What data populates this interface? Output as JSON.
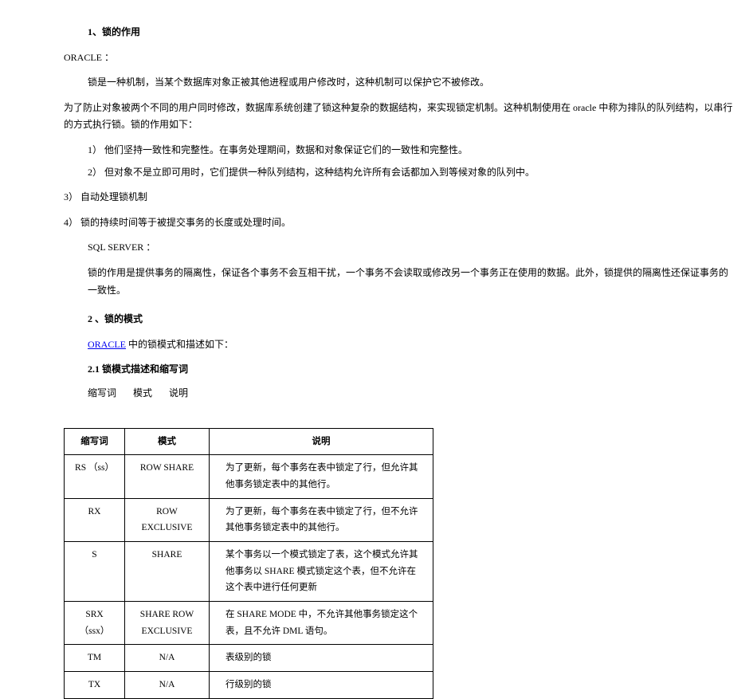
{
  "headings": {
    "h1": "1、锁的作用",
    "h2": "2 、锁的模式",
    "h2_1_title": "2.1 锁模式描述和缩写词"
  },
  "paragraphs": {
    "p_oracle_label": "ORACLE ：",
    "p_oracle_1": "锁是一种机制，当某个数据库对象正被其他进程或用户修改时，这种机制可以保护它不被修改。",
    "p_oracle_2": "为了防止对象被两个不同的用户同时修改，数据库系统创建了锁这种复杂的数据结构，来实现锁定机制。这种机制使用在  oracle 中称为排队的队列结构，以串行的方式执行锁。锁的作用如下：",
    "li1": "1）  他们坚持一致性和完整性。在事务处理期间，数据和对象保证它们的一致性和完整性。",
    "li2": "2）  但对象不是立即可用时，它们提供一种队列结构，这种结构允许所有会话都加入到等候对象的队列中。",
    "li3": "3）  自动处理锁机制",
    "li4": "4）  锁的持续时间等于被提交事务的长度或处理时间。",
    "p_sql_label": "SQL SERVER ：",
    "p_sql_1": "锁的作用是提供事务的隔离性，保证各个事务不会互相干扰，一个事务不会读取或修改另一个事务正在使用的数据。此外，锁提供的隔离性还保证事务的一致性。",
    "p_h2_sub_prefix": "ORACLE",
    "p_h2_sub": " 中的锁模式和描述如下：",
    "labels_abbr": "缩写词",
    "labels_mode": "模式",
    "labels_desc": "说明"
  },
  "table": {
    "header": {
      "c1": "缩写词",
      "c2": "模式",
      "c3": "说明"
    },
    "rows": [
      {
        "c1": "RS （ss）",
        "c2": "ROW SHARE",
        "c3": "为了更新，每个事务在表中锁定了行，但允许其他事务锁定表中的其他行。"
      },
      {
        "c1": "RX",
        "c2": "ROW EXCLUSIVE",
        "c3": "为了更新，每个事务在表中锁定了行，但不允许其他事务锁定表中的其他行。"
      },
      {
        "c1": "S",
        "c2": "SHARE",
        "c3": "某个事务以一个模式锁定了表，这个模式允许其他事务以 SHARE 模式锁定这个表，但不允许在这个表中进行任何更新"
      },
      {
        "c1": "SRX （ssx）",
        "c2": "SHARE ROW EXCLUSIVE",
        "c3": "在 SHARE MODE 中，不允许其他事务锁定这个表，且不允许 DML 语句。"
      },
      {
        "c1": "TM",
        "c2": "N/A",
        "c3": "表级别的锁"
      },
      {
        "c1": "TX",
        "c2": "N/A",
        "c3": "行级别的锁"
      }
    ]
  }
}
